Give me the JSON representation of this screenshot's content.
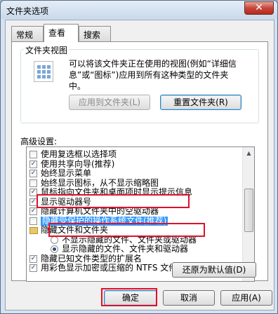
{
  "window": {
    "title": "文件夹选项",
    "close_glyph": "✕"
  },
  "tabs": [
    {
      "label": "常规"
    },
    {
      "label": "查看"
    },
    {
      "label": "搜索"
    }
  ],
  "folder_views": {
    "group_label": "文件夹视图",
    "description": "可以将该文件夹正在使用的视图(例如“详细信息”或“图标”)应用到所有这种类型的文件夹中。",
    "apply_button": "应用到文件夹(L)",
    "reset_button": "重置文件夹(R)"
  },
  "advanced": {
    "label": "高级设置:",
    "items": [
      {
        "type": "checkbox",
        "checked": false,
        "text": "使用复选框以选择项"
      },
      {
        "type": "checkbox",
        "checked": true,
        "text": "使用共享向导(推荐)"
      },
      {
        "type": "checkbox",
        "checked": true,
        "text": "始终显示菜单"
      },
      {
        "type": "checkbox",
        "checked": false,
        "text": "始终显示图标，从不显示缩略图"
      },
      {
        "type": "checkbox",
        "checked": true,
        "text": "鼠标指向文件夹和桌面项时显示提示信息"
      },
      {
        "type": "checkbox",
        "checked": true,
        "text": "显示驱动器号"
      },
      {
        "type": "checkbox",
        "checked": true,
        "text": "隐藏计算机文件夹中的空驱动器"
      },
      {
        "type": "checkbox",
        "checked": false,
        "text": "隐藏受保护的操作系统文件(推荐)",
        "selected": true
      },
      {
        "type": "folder",
        "text": "隐藏文件和文件夹"
      },
      {
        "type": "radio",
        "checked": false,
        "text": "不显示隐藏的文件、文件夹或驱动器"
      },
      {
        "type": "radio",
        "checked": true,
        "text": "显示隐藏的文件、文件夹和驱动器"
      },
      {
        "type": "checkbox",
        "checked": true,
        "text": "隐藏已知文件类型的扩展名"
      },
      {
        "type": "checkbox",
        "checked": true,
        "text": "用彩色显示加密或压缩的 NTFS 文件"
      }
    ],
    "check_glyph": "✓",
    "scroll_up": "▲",
    "scroll_down": "▼"
  },
  "restore_button": "还原为默认值(D)",
  "footer": {
    "ok": "确定",
    "cancel": "取消",
    "apply": "应用(A)"
  },
  "colors": {
    "highlight": "#e0102a",
    "selection": "#3399ff"
  }
}
